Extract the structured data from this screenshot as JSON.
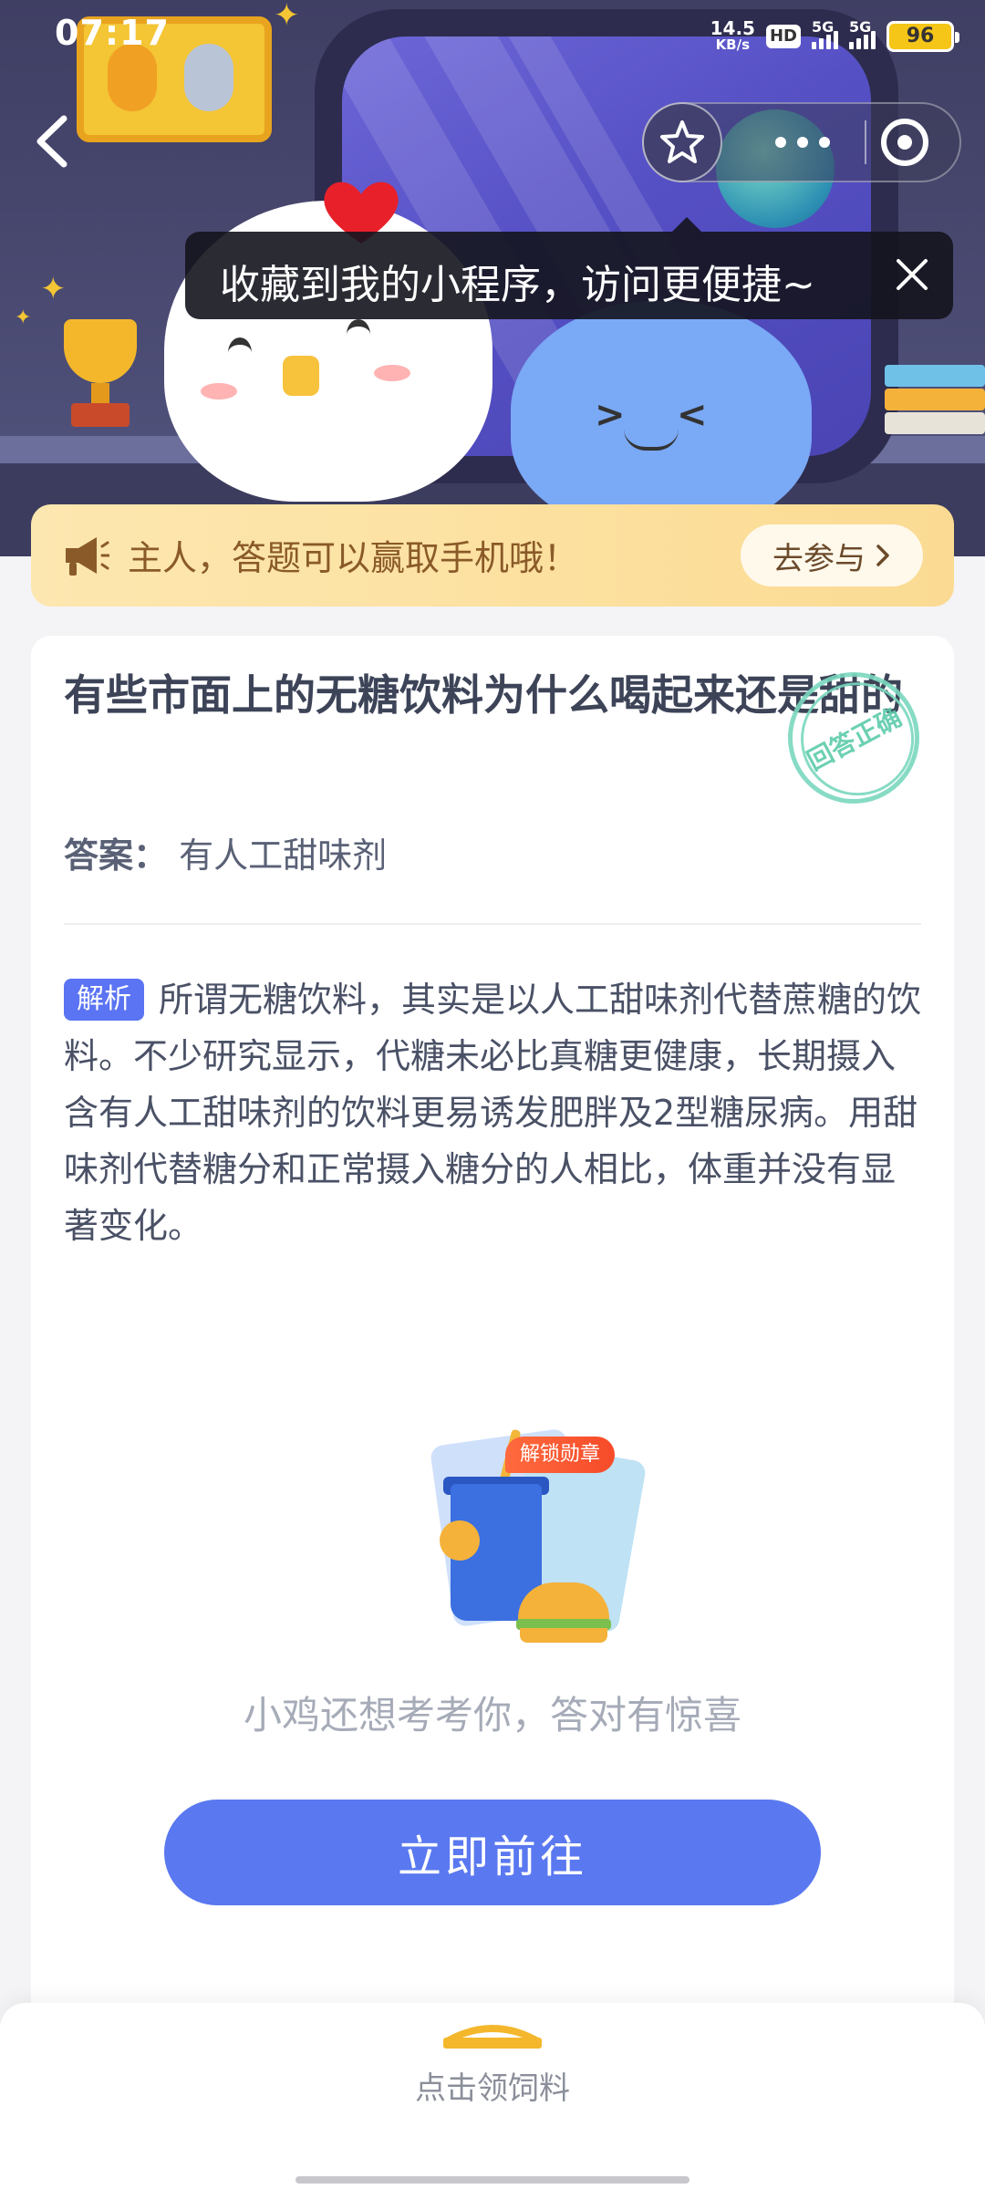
{
  "status_bar": {
    "time": "07:17",
    "net_speed_value": "14.5",
    "net_speed_unit": "KB/s",
    "hd_label": "HD",
    "sim1_label": "5G",
    "sim2_label": "5G",
    "battery": "96"
  },
  "nav": {
    "back_icon": "chevron-left-icon",
    "favorite_icon": "star-icon",
    "more_icon": "more-dots-icon",
    "close_icon": "target-circle-icon"
  },
  "tooltip": {
    "text": "收藏到我的小程序，访问更便捷~",
    "close_icon": "close-icon"
  },
  "promo": {
    "icon": "megaphone-icon",
    "text": "主人，答题可以赢取手机哦！",
    "button_label": "去参与",
    "button_icon": "chevron-right-icon"
  },
  "question": {
    "title": "有些市面上的无糖饮料为什么喝起来还是甜的",
    "stamp_text": "回答正确",
    "answer_label": "答案：",
    "answer_value": "有人工甜味剂",
    "analysis_tag": "解析",
    "analysis_text": "所谓无糖饮料，其实是以人工甜味剂代替蔗糖的饮料。不少研究显示，代糖未必比真糖更健康，长期摄入含有人工甜味剂的饮料更易诱发肥胖及2型糖尿病。用甜味剂代替糖分和正常摄入糖分的人相比，体重并没有显著变化。"
  },
  "reward": {
    "badge_label": "解锁勋章",
    "teaser_text": "小鸡还想考考你，答对有惊喜",
    "go_button_label": "立即前往"
  },
  "bottom_sheet": {
    "label": "点击领饲料"
  },
  "colors": {
    "primary": "#5a78f0",
    "promo_bg": "#fde7b0",
    "promo_text": "#8a5a28",
    "stamp": "#7bd8bf",
    "analysis_tag": "#5b74f3",
    "badge": "#f64b2a"
  }
}
